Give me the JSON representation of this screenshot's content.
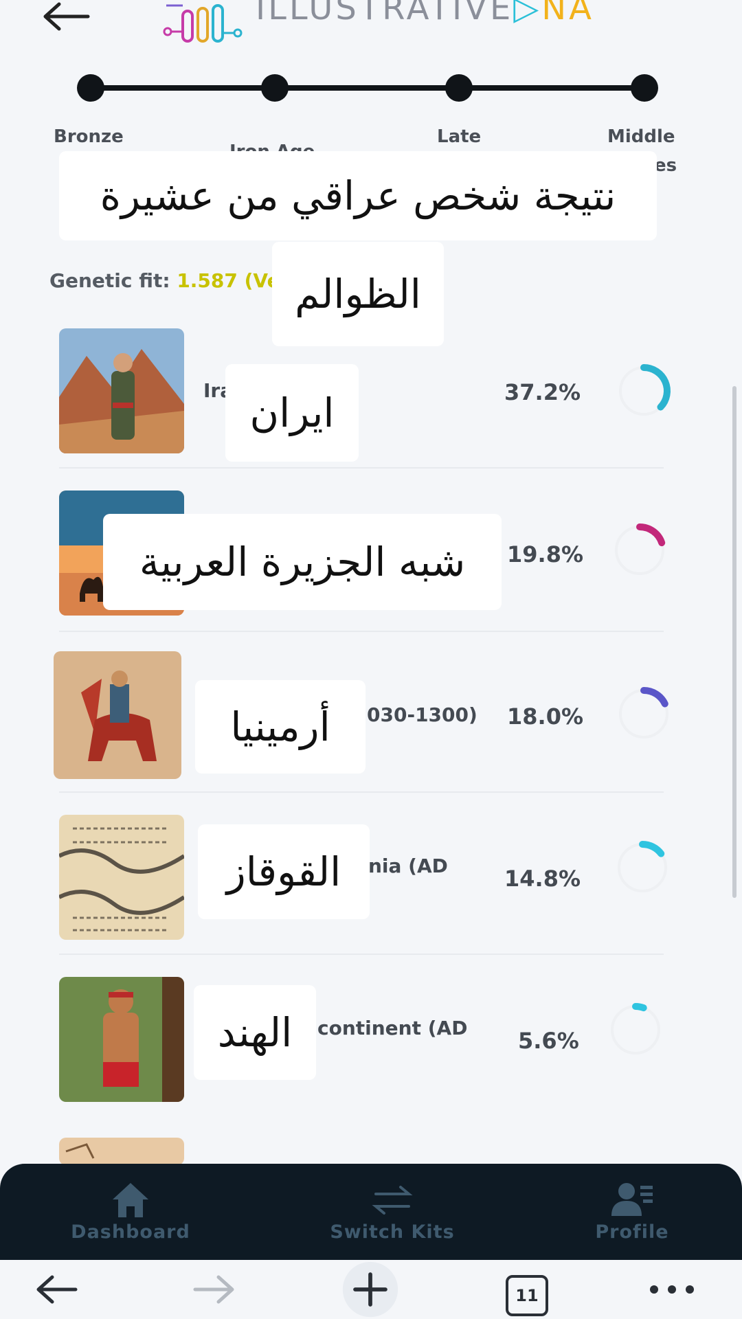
{
  "header": {
    "logo_text": "ILLUSTRATIVE",
    "logo_text_end": "NA"
  },
  "timeline": {
    "labels": [
      "Bronze",
      "Iron Age",
      "Late",
      "Middle"
    ],
    "middle_wrap": "es"
  },
  "overlays": {
    "title_line1": "نتيجة شخص عراقي من عشيرة",
    "title_line2": "الظوالم",
    "row1": "ايران",
    "row2": "شبه الجزيرة العربية",
    "row3": "أرمينيا",
    "row4": "القوقاز",
    "row5": "الهند"
  },
  "genetic_fit": {
    "label": "Genetic fit:",
    "value": "1.587 (Ver"
  },
  "rows": [
    {
      "label": "Ira",
      "pct": "37.2%",
      "fraction": 0.372,
      "color": "#2bb3cf"
    },
    {
      "label": "",
      "pct": "19.8%",
      "fraction": 0.198,
      "color": "#c2287a"
    },
    {
      "label": "030-1300)",
      "pct": "18.0%",
      "fraction": 0.18,
      "color": "#5a56c8"
    },
    {
      "label": "nia (AD",
      "pct": "14.8%",
      "fraction": 0.148,
      "color": "#2fc4e0"
    },
    {
      "label": "continent (AD",
      "pct": "5.6%",
      "fraction": 0.056,
      "color": "#2fc4e0"
    }
  ],
  "bottom_nav": {
    "dashboard": "Dashboard",
    "switch_kits": "Switch Kits",
    "profile": "Profile"
  },
  "browser": {
    "tab_count": "11"
  }
}
